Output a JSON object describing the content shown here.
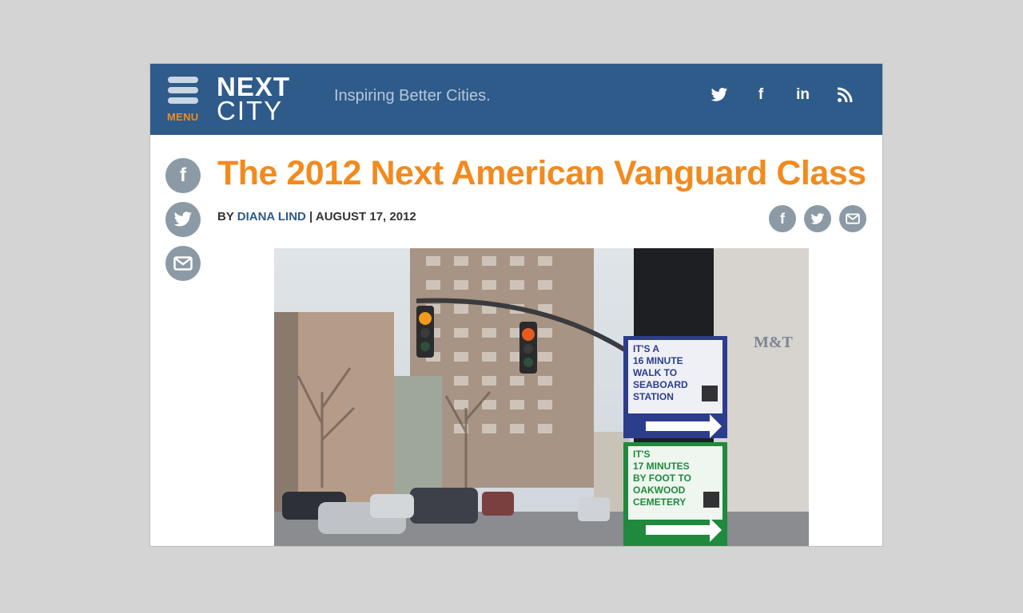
{
  "header": {
    "menu_label": "MENU",
    "logo_line1": "NEXT",
    "logo_line2": "CITY",
    "tagline": "Inspiring Better Cities.",
    "social": [
      {
        "name": "twitter-icon",
        "glyph": "🐦"
      },
      {
        "name": "facebook-icon",
        "glyph": "f"
      },
      {
        "name": "linkedin-icon",
        "glyph": "in"
      },
      {
        "name": "rss-icon",
        "glyph": "rss"
      }
    ]
  },
  "article": {
    "title": "The 2012 Next American Vanguard Class",
    "by_prefix": "BY",
    "author": "DIANA LIND",
    "separator": "|",
    "date": "AUGUST 17, 2012"
  },
  "photo": {
    "sign1_lines": [
      "IT'S A",
      "16 MINUTE",
      "WALK TO",
      "SEABOARD",
      "STATION"
    ],
    "sign2_lines": [
      "IT'S",
      "17 MINUTES",
      "BY FOOT TO",
      "OAKWOOD",
      "CEMETERY"
    ],
    "building_letters": "M&T"
  },
  "colors": {
    "header_bg": "#2f5b8a",
    "accent_orange": "#f28a1e",
    "share_gray": "#8c9aa6",
    "sign1_blue": "#2c3d8c",
    "sign2_green": "#1f8a3d"
  }
}
